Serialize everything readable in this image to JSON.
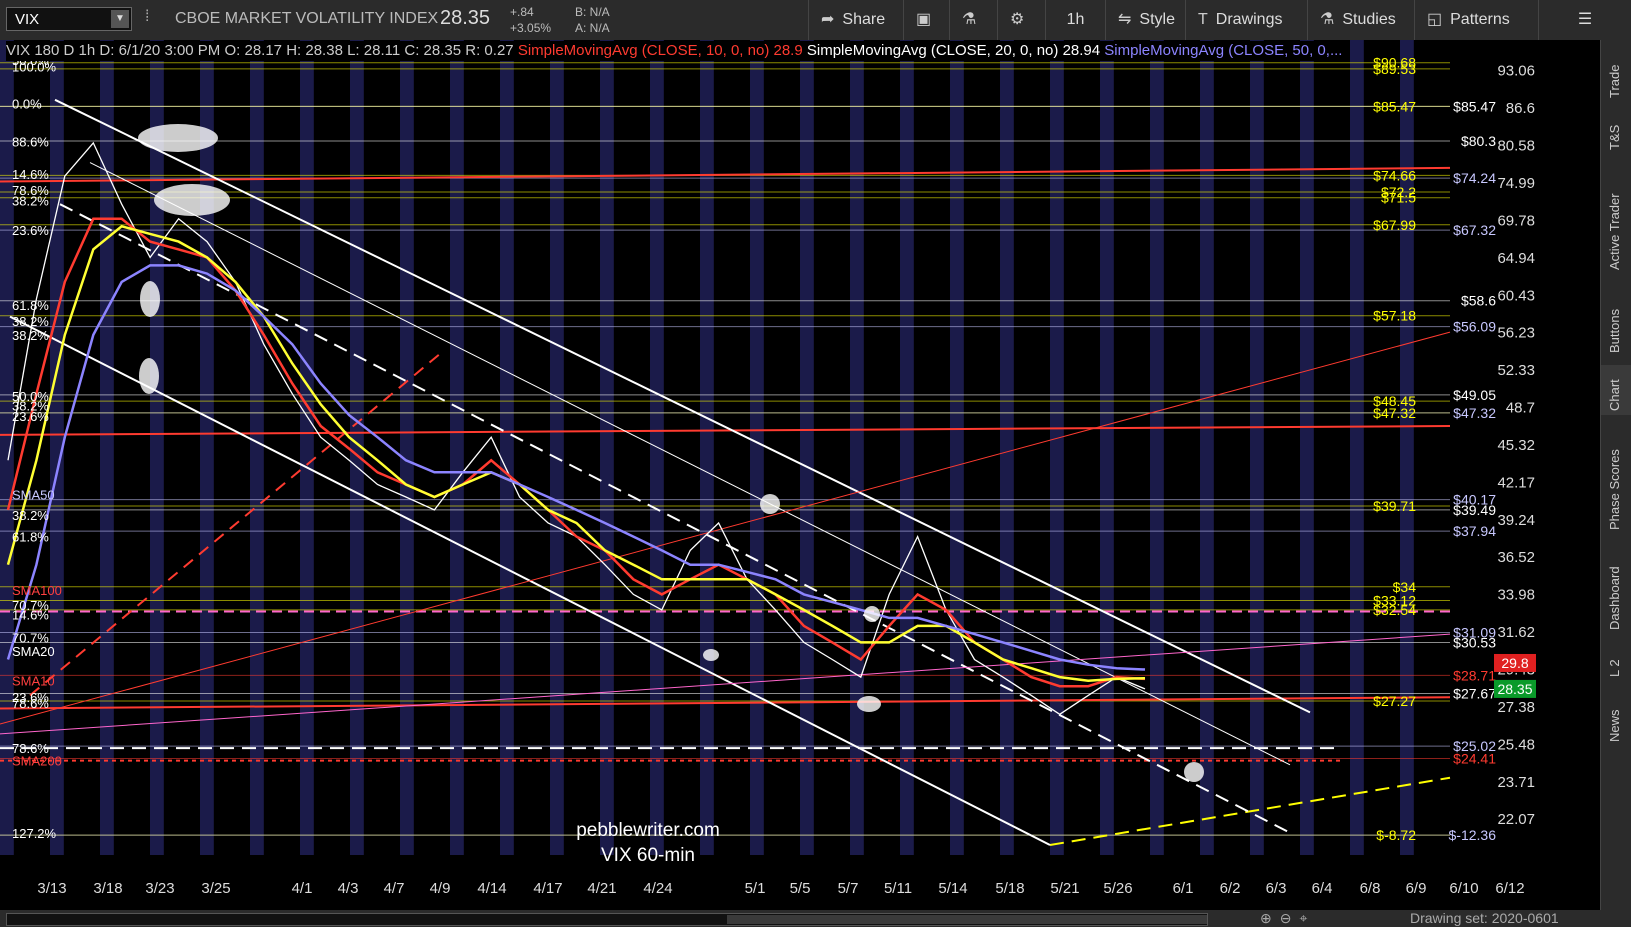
{
  "toolbar": {
    "symbol": "VIX",
    "instrument_name": "CBOE MARKET VOLATILITY INDEX",
    "last_price": "28.35",
    "change_abs": "+.84",
    "change_pct": "+3.05%",
    "bid": "B: N/A",
    "ask": "A: N/A",
    "share_label": "Share",
    "timeframe_label": "1h",
    "style_label": "Style",
    "drawings_label": "Drawings",
    "studies_label": "Studies",
    "patterns_label": "Patterns"
  },
  "infobar": {
    "desc": "VIX 180 D 1h",
    "date": "D: 6/1/20 3:00 PM",
    "open": "O: 28.17",
    "high": "H: 28.38",
    "low": "L: 28.11",
    "close": "C: 28.35",
    "range": "R: 0.27",
    "sma10_label": "SimpleMovingAvg (CLOSE, 10, 0, no)",
    "sma10_value": "28.9",
    "sma20_label": "SimpleMovingAvg (CLOSE, 20, 0, no)",
    "sma20_value": "28.94",
    "sma50_label": "SimpleMovingAvg (CLOSE, 50, 0,..."
  },
  "sidebar": {
    "tabs": [
      "Trade",
      "T&S",
      "Active Trader",
      "Buttons",
      "Chart",
      "Phase Scores",
      "Dashboard",
      "L 2",
      "News"
    ]
  },
  "bottombar": {
    "drawing_set": "Drawing set: 2020-0601"
  },
  "colors": {
    "background": "#000000",
    "band": "#1b1b4a",
    "sma10": "#ff3b30",
    "sma20": "#ffff33",
    "sma50": "#8c84ff",
    "price_line": "#ffffff",
    "fib_yellow": "#ffff00",
    "fib_white": "#ffffff"
  },
  "chart_data": {
    "type": "line",
    "title": "VIX 180 D 1h",
    "watermark": [
      "pebblewriter.com",
      "VIX 60-min"
    ],
    "x_ticks": [
      "3/13",
      "3/18",
      "3/23",
      "3/25",
      "4/1",
      "4/3",
      "4/7",
      "4/9",
      "4/14",
      "4/17",
      "4/21",
      "4/24",
      "5/1",
      "5/5",
      "5/7",
      "5/11",
      "5/14",
      "5/18",
      "5/21",
      "5/26",
      "6/1",
      "6/2",
      "6/3",
      "6/4",
      "6/8",
      "6/9",
      "6/10",
      "6/12"
    ],
    "y_ticks": [
      93.06,
      86.6,
      80.58,
      74.99,
      69.78,
      64.94,
      60.43,
      56.23,
      52.33,
      48.7,
      45.32,
      42.17,
      39.24,
      36.52,
      33.98,
      31.62,
      29.43,
      27.38,
      25.48,
      23.71,
      22.07
    ],
    "ylim": [
      21.0,
      95.0
    ],
    "y_scale": "log",
    "grid": false,
    "series": [
      {
        "name": "VIX",
        "color": "#ffffff",
        "values": [
          44,
          60,
          76,
          81,
          72,
          65,
          70,
          67,
          62,
          55,
          50,
          46,
          44,
          42,
          41,
          40,
          43,
          46,
          41,
          39,
          38,
          36,
          34,
          33,
          37,
          39,
          35,
          33,
          31,
          30,
          29,
          34,
          38,
          33,
          30,
          29,
          28,
          27,
          28,
          29,
          28.35
        ]
      },
      {
        "name": "SMA10",
        "color": "#ff3b30",
        "values": [
          40,
          50,
          62,
          70,
          70,
          67,
          66,
          65,
          61,
          56,
          51,
          47,
          45,
          43,
          42,
          41,
          42,
          44,
          42,
          40,
          38,
          37,
          35,
          34,
          35,
          36,
          35,
          34,
          32,
          31,
          30,
          32,
          34,
          33,
          31,
          30,
          29,
          28.5,
          28.5,
          29,
          28.9
        ]
      },
      {
        "name": "SMA20",
        "color": "#ffff33",
        "values": [
          36,
          44,
          56,
          66,
          69,
          68,
          67,
          65,
          62,
          58,
          53,
          49,
          46,
          44,
          42,
          41,
          42,
          43,
          42,
          40,
          39,
          37,
          36,
          35,
          35,
          35,
          35,
          34,
          33,
          32,
          31,
          31,
          32,
          32,
          31,
          30,
          29.5,
          29,
          28.8,
          28.9,
          28.94
        ]
      },
      {
        "name": "SMA50",
        "color": "#8c84ff",
        "values": [
          30,
          36,
          46,
          56,
          62,
          64,
          64,
          63,
          61,
          58,
          55,
          51,
          48,
          46,
          44,
          43,
          43,
          43,
          42,
          41,
          40,
          39,
          38,
          37,
          36,
          36,
          35.5,
          35,
          34,
          33.5,
          33,
          32.5,
          32.5,
          32,
          31.5,
          31,
          30.5,
          30,
          29.7,
          29.5,
          29.43
        ]
      }
    ],
    "fib_labels_left": [
      {
        "label": "50.0%",
        "value": 95.0
      },
      {
        "label": "100.0%",
        "value": 93.8
      },
      {
        "label": "0.0%",
        "value": 87.4
      },
      {
        "label": "88.6%",
        "value": 81.2
      },
      {
        "label": "14.6%",
        "value": 76.3
      },
      {
        "label": "78.6%",
        "value": 74.0
      },
      {
        "label": "38.2%",
        "value": 72.5
      },
      {
        "label": "23.6%",
        "value": 68.5
      },
      {
        "label": "61.8%",
        "value": 59.3
      },
      {
        "label": "38.2%",
        "value": 57.5
      },
      {
        "label": "38.2%",
        "value": 56.0
      },
      {
        "label": "50.0%",
        "value": 49.8
      },
      {
        "label": "38.2%",
        "value": 48.9
      },
      {
        "label": "23.6%",
        "value": 47.9
      },
      {
        "label": "SMA50",
        "value": 41.2
      },
      {
        "label": "38.2%",
        "value": 39.6
      },
      {
        "label": "61.8%",
        "value": 38.0
      },
      {
        "label": "SMA100",
        "value": 34.3
      },
      {
        "label": "70.7%",
        "value": 33.3
      },
      {
        "label": "14.6%",
        "value": 32.7
      },
      {
        "label": "70.7%",
        "value": 31.3
      },
      {
        "label": "SMA20",
        "value": 30.5
      },
      {
        "label": "SMA10",
        "value": 28.8
      },
      {
        "label": "23.6%",
        "value": 27.9
      },
      {
        "label": "78.6%",
        "value": 27.6
      },
      {
        "label": "78.6%",
        "value": 25.3
      },
      {
        "label": "SMA200",
        "value": 24.7
      },
      {
        "label": "127.2%",
        "value": 21.5
      }
    ],
    "level_labels_right": [
      {
        "label": "$90.68",
        "value": 94.5,
        "color": "#ffff00"
      },
      {
        "label": "$89.53",
        "value": 93.4,
        "color": "#ffff00"
      },
      {
        "label": "$85.47",
        "value": 86.9,
        "color": "#ffff00"
      },
      {
        "label": "$85.47",
        "value": 86.9,
        "color": "#ffffff"
      },
      {
        "label": "$80.3",
        "value": 81.3,
        "color": "#ffffff"
      },
      {
        "label": "$74.66",
        "value": 76.1,
        "color": "#ffff00"
      },
      {
        "label": "$74.24",
        "value": 75.7,
        "color": "#c8c8ff"
      },
      {
        "label": "$72.2",
        "value": 73.7,
        "color": "#ffff00"
      },
      {
        "label": "$71.5",
        "value": 72.9,
        "color": "#ffff00"
      },
      {
        "label": "$67.99",
        "value": 69.2,
        "color": "#ffff00"
      },
      {
        "label": "$67.32",
        "value": 68.5,
        "color": "#c8c8ff"
      },
      {
        "label": "$58.6",
        "value": 59.8,
        "color": "#ffffff"
      },
      {
        "label": "$57.18",
        "value": 58.1,
        "color": "#ffff00"
      },
      {
        "label": "$56.09",
        "value": 56.9,
        "color": "#c8c8ff"
      },
      {
        "label": "$49.05",
        "value": 49.9,
        "color": "#ffffff"
      },
      {
        "label": "$48.45",
        "value": 49.3,
        "color": "#ffff00"
      },
      {
        "label": "$47.32",
        "value": 48.2,
        "color": "#ffff00"
      },
      {
        "label": "$47.32",
        "value": 48.2,
        "color": "#c8c8ff"
      },
      {
        "label": "$39.71",
        "value": 40.3,
        "color": "#ffff00"
      },
      {
        "label": "$40.17",
        "value": 40.8,
        "color": "#c8c8ff"
      },
      {
        "label": "$39.49",
        "value": 40.0,
        "color": "#ffffff"
      },
      {
        "label": "$37.94",
        "value": 38.4,
        "color": "#c8c8ff"
      },
      {
        "label": "$34",
        "value": 34.5,
        "color": "#ffff00"
      },
      {
        "label": "$33.12",
        "value": 33.6,
        "color": "#ffff00"
      },
      {
        "label": "$32.54",
        "value": 33.0,
        "color": "#ffff00"
      },
      {
        "label": "$31.09",
        "value": 31.6,
        "color": "#c8c8ff"
      },
      {
        "label": "$30.53",
        "value": 31.0,
        "color": "#ffffff"
      },
      {
        "label": "$28.71",
        "value": 29.1,
        "color": "#ff3b30"
      },
      {
        "label": "$27.67",
        "value": 28.1,
        "color": "#ffffff"
      },
      {
        "label": "$27.27",
        "value": 27.7,
        "color": "#ffff00"
      },
      {
        "label": "$25.02",
        "value": 25.4,
        "color": "#c8c8ff"
      },
      {
        "label": "$24.41",
        "value": 24.8,
        "color": "#ff3b30"
      },
      {
        "label": "$-8.72",
        "value": 21.4,
        "color": "#ffff00"
      },
      {
        "label": "$-12.36",
        "value": 21.4,
        "color": "#c8c8ff"
      }
    ],
    "price_flags": [
      {
        "label": "29.8",
        "value": 29.8,
        "color": "#e02020"
      },
      {
        "label": "28.35",
        "value": 28.35,
        "color": "#0a9a2a"
      }
    ]
  }
}
